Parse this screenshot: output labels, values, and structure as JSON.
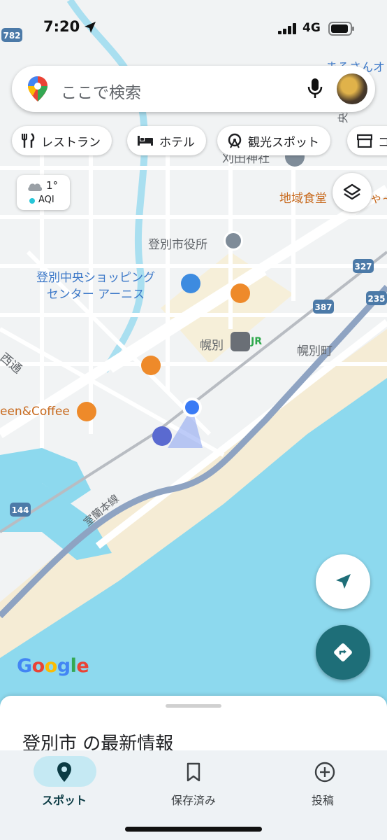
{
  "status_bar": {
    "time": "7:20",
    "network": "4G"
  },
  "search": {
    "placeholder": "ここで検索"
  },
  "chips": [
    {
      "label": "レストラン",
      "icon": "fork-knife-icon"
    },
    {
      "label": "ホテル",
      "icon": "bed-icon"
    },
    {
      "label": "観光スポット",
      "icon": "ferris-wheel-icon"
    },
    {
      "label": "コ",
      "icon": "shop-icon"
    }
  ],
  "weather": {
    "temp": "1°",
    "aqi": "AQI"
  },
  "map": {
    "labels": {
      "city_hall": "登別市役所",
      "mall": "登別中央ショッピング\nセンター アーニス",
      "station": "幌別",
      "jr": "JR",
      "town": "幌別町",
      "shrine": "刈田神社",
      "food": "地域食堂",
      "food_tail": "ゃ~",
      "street": "西通",
      "cafe": "een&Coffee",
      "rail_line": "室蘭本線",
      "top_right": "まるさんオ",
      "top_right2": "央通"
    },
    "route_shields": [
      "782",
      "327",
      "235",
      "387",
      "144"
    ],
    "colors": {
      "water": "#8dd9ee",
      "land": "#f1f3f4",
      "road": "#ffffff",
      "beach": "#f5ecd5",
      "highway": "#8ea3c2"
    }
  },
  "logo": "Google",
  "sheet": {
    "title": "登別市 の最新情報"
  },
  "bottom_nav": [
    {
      "label": "スポット",
      "icon": "pin-icon",
      "active": true
    },
    {
      "label": "保存済み",
      "icon": "bookmark-icon",
      "active": false
    },
    {
      "label": "投稿",
      "icon": "add-circle-icon",
      "active": false
    }
  ]
}
